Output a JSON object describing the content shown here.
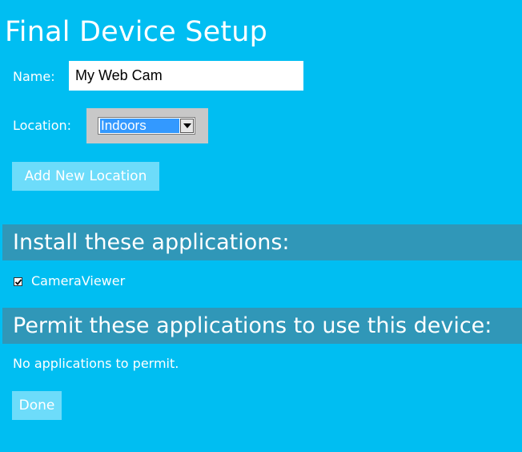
{
  "page": {
    "title": "Final Device Setup"
  },
  "form": {
    "name_label": "Name:",
    "name_value": "My Web Cam",
    "location_label": "Location:",
    "location_value": "Indoors",
    "add_location_label": "Add New Location"
  },
  "install": {
    "header": "Install these applications:",
    "apps": [
      {
        "label": "CameraViewer",
        "checked": true
      }
    ]
  },
  "permit": {
    "header": "Permit these applications to use this device:",
    "empty_text": "No applications to permit."
  },
  "footer": {
    "done_label": "Done"
  },
  "colors": {
    "background": "#00bef2",
    "section_header": "#3097b8",
    "button": "#6ddcfa",
    "select_highlight": "#3399ff"
  }
}
